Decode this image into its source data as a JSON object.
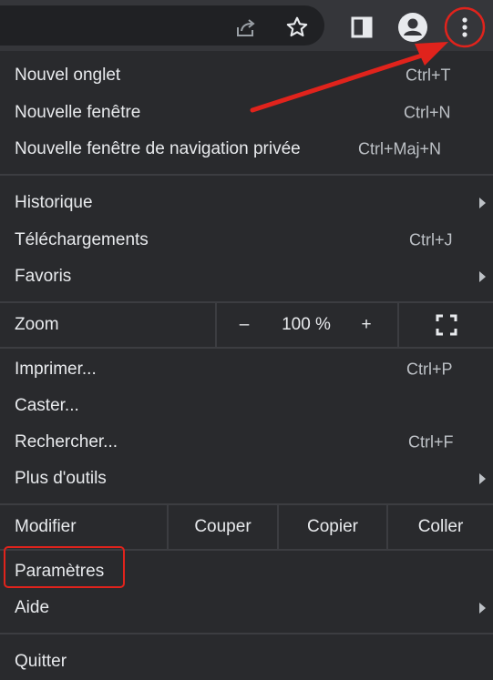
{
  "toolbar": {
    "share_icon": "share-icon",
    "bookmark_icon": "star-icon",
    "sidepanel_icon": "side-panel-icon",
    "profile_icon": "profile-icon",
    "menu_icon": "three-dots-vertical-icon"
  },
  "menu": {
    "new_tab": {
      "label": "Nouvel onglet",
      "shortcut": "Ctrl+T"
    },
    "new_window": {
      "label": "Nouvelle fenêtre",
      "shortcut": "Ctrl+N"
    },
    "incognito": {
      "label": "Nouvelle fenêtre de navigation privée",
      "shortcut": "Ctrl+Maj+N"
    },
    "history": {
      "label": "Historique"
    },
    "downloads": {
      "label": "Téléchargements",
      "shortcut": "Ctrl+J"
    },
    "bookmarks": {
      "label": "Favoris"
    },
    "zoom": {
      "label": "Zoom",
      "minus": "–",
      "value": "100 %",
      "plus": "+",
      "fullscreen_icon": "fullscreen-icon"
    },
    "print": {
      "label": "Imprimer...",
      "shortcut": "Ctrl+P"
    },
    "cast": {
      "label": "Caster..."
    },
    "find": {
      "label": "Rechercher...",
      "shortcut": "Ctrl+F"
    },
    "more_tools": {
      "label": "Plus d'outils"
    },
    "edit": {
      "label": "Modifier",
      "cut": "Couper",
      "copy": "Copier",
      "paste": "Coller"
    },
    "settings": {
      "label": "Paramètres"
    },
    "help": {
      "label": "Aide"
    },
    "quit": {
      "label": "Quitter"
    }
  },
  "colors": {
    "menu_bg": "#292a2d",
    "toolbar_bg": "#35363a",
    "text": "#e8eaed",
    "annotation_red": "#e0231c"
  }
}
